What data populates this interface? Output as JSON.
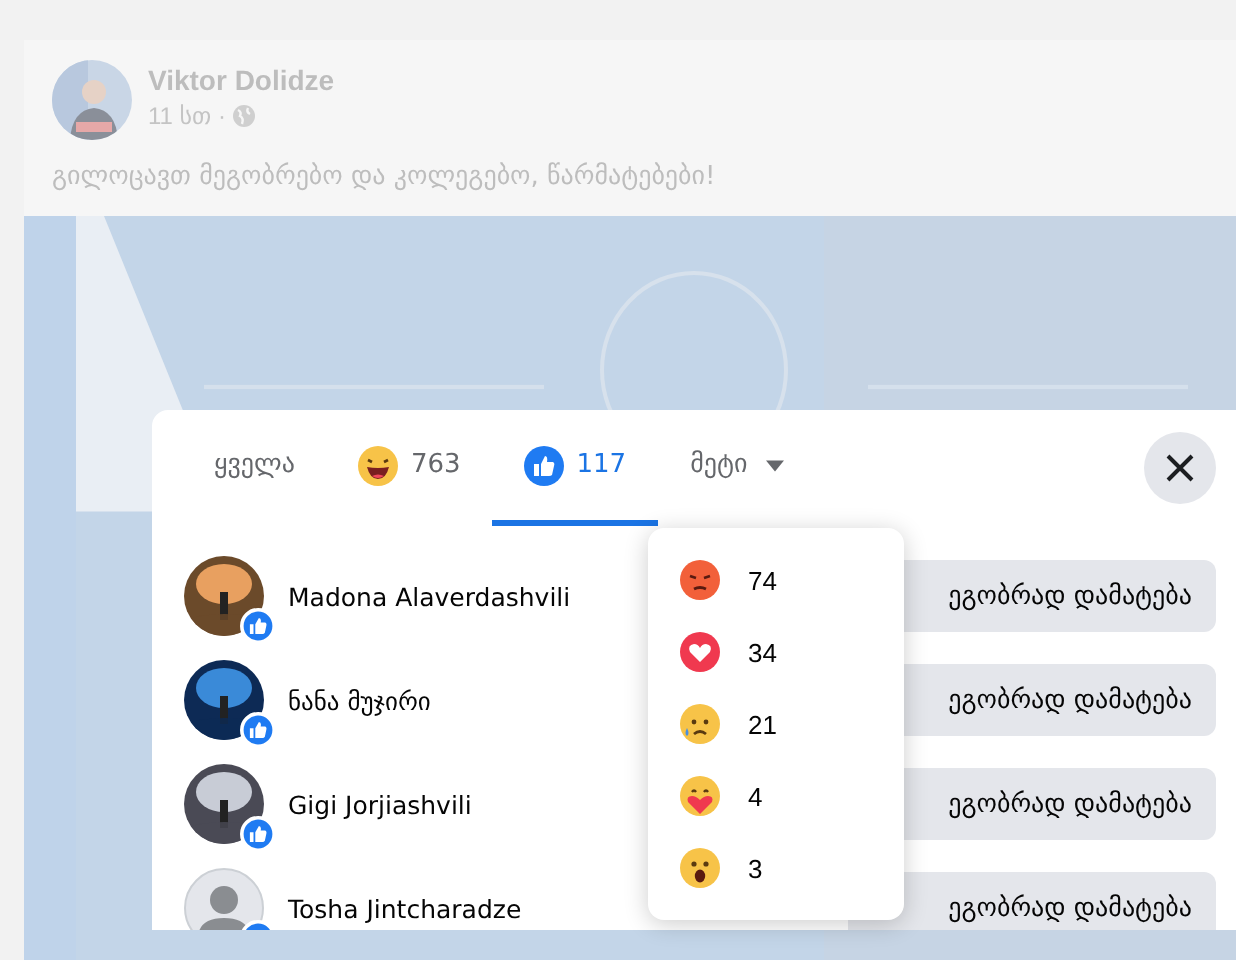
{
  "post": {
    "author": "Viktor Dolidze",
    "time": "11 სთ ·",
    "text": "გილოცავთ მეგობრებო და კოლეგებო, წარმატებები!"
  },
  "dialog": {
    "tabs": [
      {
        "kind": "all",
        "label": "ყველა",
        "selected": false
      },
      {
        "kind": "haha",
        "label": "763",
        "selected": false
      },
      {
        "kind": "like",
        "label": "117",
        "selected": true
      },
      {
        "kind": "more",
        "label": "მეტი",
        "selected": false
      }
    ],
    "people": [
      {
        "name": "Madona Alaverdashvili",
        "liked": true,
        "button": "ეგობრად დამატება"
      },
      {
        "name": "ნანა მუჯირი",
        "liked": true,
        "button": "ეგობრად დამატება"
      },
      {
        "name": "Gigi Jorjiashvili",
        "liked": true,
        "button": "ეგობრად დამატება"
      },
      {
        "name": "Tosha Jintcharadze",
        "avatar": {
          "kind": "default"
        },
        "liked": true,
        "button": "ეგობრად დამატება"
      }
    ],
    "more_menu": [
      {
        "kind": "angry",
        "count": "74"
      },
      {
        "kind": "love",
        "count": "34"
      },
      {
        "kind": "care_sad",
        "count": "21"
      },
      {
        "kind": "care",
        "count": "4"
      },
      {
        "kind": "wow",
        "count": "3"
      }
    ]
  }
}
